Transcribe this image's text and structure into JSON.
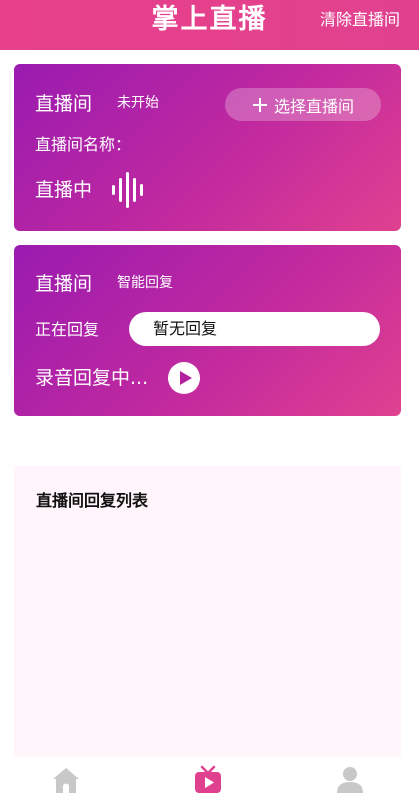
{
  "header": {
    "title": "掌上直播",
    "clear_button": "清除直播间"
  },
  "room_card": {
    "room_label": "直播间",
    "status": "未开始",
    "select_button": "选择直播间",
    "room_name_label": "直播间名称：",
    "live_label": "直播中"
  },
  "reply_card": {
    "room_label": "直播间",
    "mode": "智能回复",
    "replying_label": "正在回复",
    "reply_value": "暂无回复",
    "recording_label": "录音回复中..."
  },
  "reply_list": {
    "title": "直播间回复列表"
  },
  "tabbar": {
    "items": [
      {
        "icon": "home-icon",
        "active": false
      },
      {
        "icon": "tv-icon",
        "active": true
      },
      {
        "icon": "user-icon",
        "active": false
      }
    ]
  },
  "colors": {
    "brand_pink": "#e0418f",
    "card_gradient_start": "#9a1bb0",
    "card_gradient_end": "#e0418f",
    "inactive_icon": "#c8c8c8",
    "list_background": "#fff5fb"
  }
}
